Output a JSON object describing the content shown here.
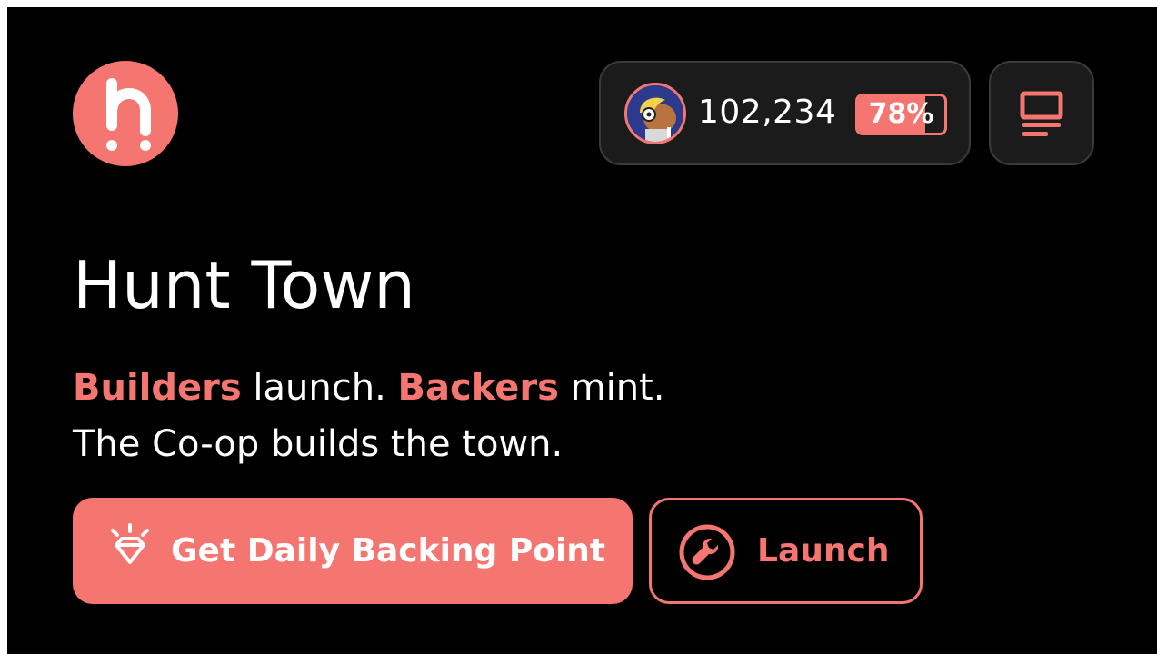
{
  "colors": {
    "accent": "#f57570",
    "background": "#000000",
    "panel": "#1b1b1b",
    "panel_border": "#3a3a3a",
    "text": "#ffffff"
  },
  "header": {
    "logo_icon": "hunt-logo-icon",
    "points_value": "102,234",
    "battery_percent_label": "78%",
    "battery_level": 0.78,
    "menu_icon": "monitor-menu-icon"
  },
  "hero": {
    "title": "Hunt Town",
    "tagline": {
      "part1_accent": "Builders",
      "part2": " launch. ",
      "part3_accent": "Backers",
      "part4": " mint.",
      "line2": "The Co-op builds the town."
    }
  },
  "actions": {
    "primary_label": "Get Daily Backing Point",
    "primary_icon": "diamond-sparkle-icon",
    "secondary_label": "Launch",
    "secondary_icon": "wrench-icon"
  }
}
